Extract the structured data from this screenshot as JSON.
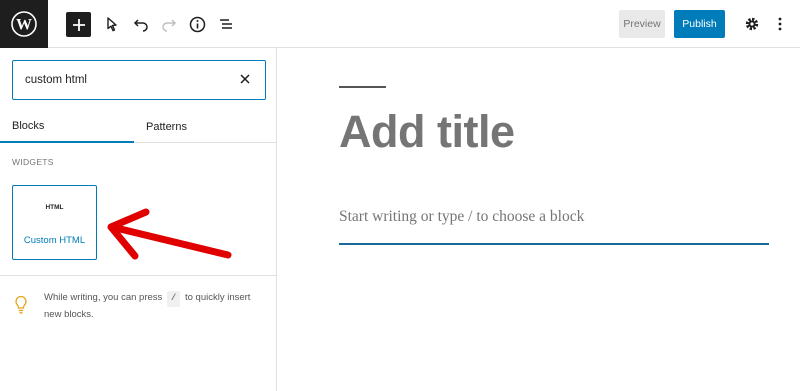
{
  "topbar": {
    "logo_icon": "wordpress-logo-icon",
    "inserter_icon": "plus-icon",
    "tools": [
      "select-tool-icon",
      "undo-icon",
      "redo-icon",
      "info-icon",
      "list-view-icon"
    ],
    "preview_label": "Preview",
    "publish_label": "Publish",
    "settings_icon": "gear-icon",
    "more_icon": "more-vertical-icon",
    "accent_color": "#007cba"
  },
  "inserter": {
    "search": {
      "value": "custom html",
      "clear_icon": "close-icon"
    },
    "tabs": [
      {
        "label": "Blocks",
        "active": true
      },
      {
        "label": "Patterns",
        "active": false
      }
    ],
    "section_label": "WIDGETS",
    "blocks": [
      {
        "icon_text": "HTML",
        "label": "Custom HTML"
      }
    ],
    "tip": {
      "icon": "lightbulb-icon",
      "before": "While writing, you can press",
      "key": "/",
      "after": "to quickly insert new blocks."
    }
  },
  "annotation": {
    "arrow_color": "#e00000"
  },
  "editor": {
    "title_placeholder": "Add title",
    "block_placeholder": "Start writing or type / to choose a block"
  }
}
